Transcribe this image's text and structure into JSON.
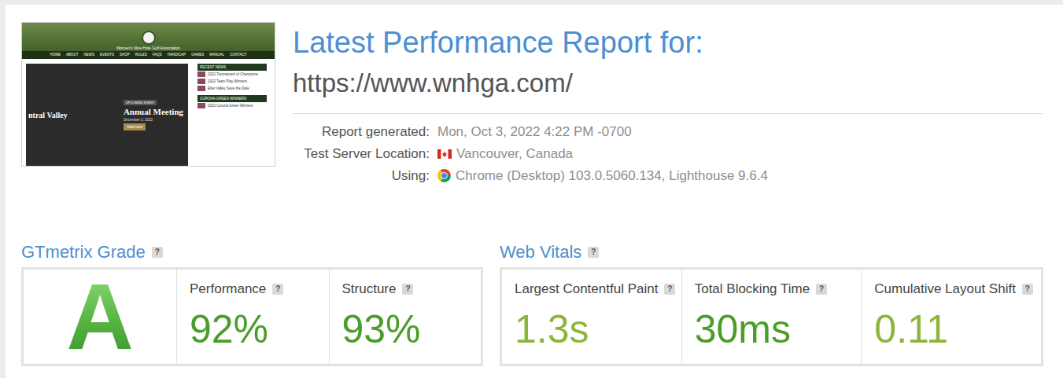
{
  "thumbnail": {
    "site_name": "Women's Nine Hole Golf Association",
    "nav": [
      "HOME",
      "ABOUT",
      "NEWS",
      "EVENTS",
      "SHOP",
      "RULES",
      "FAQS",
      "HANDICAP",
      "GAMES",
      "MANUAL",
      "CONTACT"
    ],
    "hero_text": "ntral Valley",
    "event": {
      "badge": "UPCOMING EVENT",
      "title": "Annual Meeting",
      "date": "December 2, 2022",
      "button": "read more"
    },
    "sidebar": [
      {
        "heading": "RECENT NEWS",
        "items": [
          "2022 Tournament of Champions",
          "2022 Team Play Winners",
          "Eber Valley Save the Date"
        ]
      },
      {
        "heading": "CORONA GREEN WINNERS",
        "items": [
          "2022 Corona Green Winners"
        ]
      }
    ]
  },
  "title": "Latest Performance Report for:",
  "url": "https://www.wnhga.com/",
  "details": [
    {
      "label": "Report generated:",
      "value": "Mon, Oct 3, 2022 4:22 PM -0700",
      "kind": "text"
    },
    {
      "label": "Test Server Location:",
      "value": "Vancouver, Canada",
      "kind": "flag"
    },
    {
      "label": "Using:",
      "value": "Chrome (Desktop) 103.0.5060.134, Lighthouse 9.6.4",
      "kind": "browser"
    }
  ],
  "grade": {
    "title": "GTmetrix Grade",
    "help": "?",
    "letter": "A",
    "metrics": [
      {
        "label": "Performance",
        "help": "?",
        "value": "92%",
        "color": "#4a9d2a"
      },
      {
        "label": "Structure",
        "help": "?",
        "value": "93%",
        "color": "#4a9d2a"
      }
    ]
  },
  "web_vitals": {
    "title": "Web Vitals",
    "help": "?",
    "metrics": [
      {
        "label": "Largest Contentful Paint",
        "help": "?",
        "value": "1.3s",
        "color": "#8bb63a"
      },
      {
        "label": "Total Blocking Time",
        "help": "?",
        "value": "30ms",
        "color": "#4a9d2a"
      },
      {
        "label": "Cumulative Layout Shift",
        "help": "?",
        "value": "0.11",
        "color": "#8bb63a"
      }
    ]
  }
}
